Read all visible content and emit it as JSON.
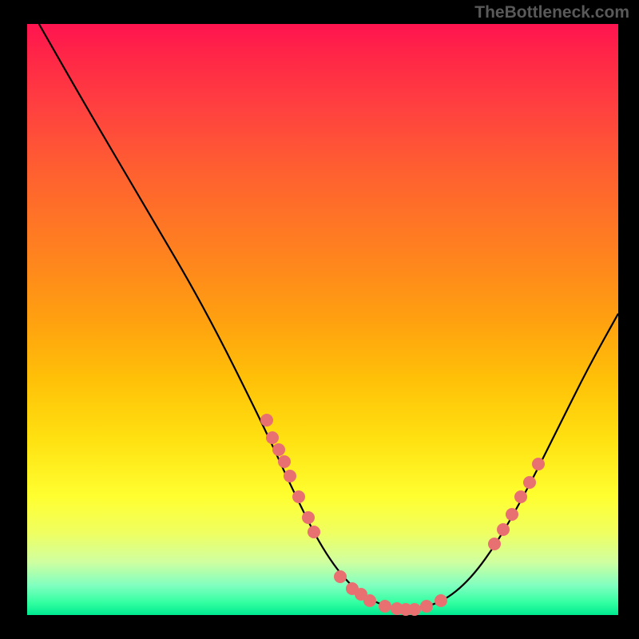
{
  "watermark": "TheBottleneck.com",
  "chart_data": {
    "type": "line",
    "title": "",
    "xlabel": "",
    "ylabel": "",
    "xlim": [
      0,
      100
    ],
    "ylim": [
      0,
      100
    ],
    "series": [
      {
        "name": "curve",
        "x": [
          2,
          10,
          20,
          30,
          40,
          45,
          50,
          55,
          60,
          65,
          70,
          75,
          80,
          85,
          90,
          95,
          100
        ],
        "y": [
          100,
          86,
          69,
          52,
          32,
          21,
          11,
          4.5,
          1.5,
          1,
          2,
          6,
          13,
          22,
          32,
          42,
          51
        ]
      }
    ],
    "markers_left": [
      {
        "x": 40.5,
        "y": 33
      },
      {
        "x": 41.5,
        "y": 30
      },
      {
        "x": 42.5,
        "y": 28
      },
      {
        "x": 43.5,
        "y": 26
      },
      {
        "x": 44.5,
        "y": 23.5
      },
      {
        "x": 46,
        "y": 20
      },
      {
        "x": 47.5,
        "y": 16.5
      },
      {
        "x": 48.5,
        "y": 14
      }
    ],
    "markers_bottom": [
      {
        "x": 53,
        "y": 6.5
      },
      {
        "x": 55,
        "y": 4.5
      },
      {
        "x": 56.5,
        "y": 3.5
      },
      {
        "x": 58,
        "y": 2.5
      },
      {
        "x": 60.5,
        "y": 1.5
      },
      {
        "x": 62.5,
        "y": 1.1
      },
      {
        "x": 64,
        "y": 0.9
      },
      {
        "x": 65.5,
        "y": 1
      },
      {
        "x": 67.5,
        "y": 1.5
      },
      {
        "x": 70,
        "y": 2.5
      }
    ],
    "markers_right": [
      {
        "x": 79,
        "y": 12
      },
      {
        "x": 80.5,
        "y": 14.5
      },
      {
        "x": 82,
        "y": 17
      },
      {
        "x": 83.5,
        "y": 20
      },
      {
        "x": 85,
        "y": 22.5
      },
      {
        "x": 86.5,
        "y": 25.5
      }
    ]
  }
}
